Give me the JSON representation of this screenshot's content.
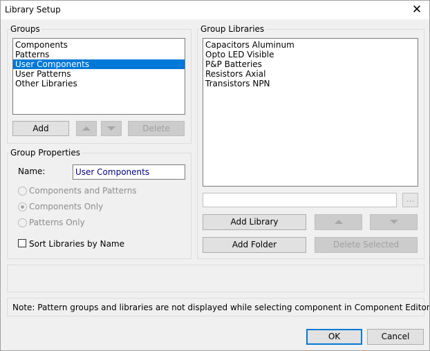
{
  "window": {
    "title": "Library Setup"
  },
  "groups": {
    "label": "Groups",
    "items": [
      "Components",
      "Patterns",
      "User Components",
      "User Patterns",
      "Other Libraries"
    ],
    "selected_index": 2,
    "add_label": "Add",
    "delete_label": "Delete"
  },
  "group_properties": {
    "label": "Group Properties",
    "name_label": "Name:",
    "name_value": "User Components",
    "radio_components_patterns": "Components and Patterns",
    "radio_components_only": "Components Only",
    "radio_patterns_only": "Patterns Only",
    "sort_label": "Sort Libraries by Name",
    "sort_checked": false
  },
  "group_libraries": {
    "label": "Group Libraries",
    "items": [
      "Capacitors Aluminum",
      "Opto LED Visible",
      "P&P Batteries",
      "Resistors Axial",
      "Transistors NPN"
    ],
    "path_value": "",
    "browse_label": "...",
    "add_library_label": "Add Library",
    "add_folder_label": "Add Folder",
    "delete_selected_label": "Delete Selected"
  },
  "note": "Note: Pattern groups and libraries are not displayed while selecting component in Component Editor.",
  "buttons": {
    "ok": "OK",
    "cancel": "Cancel"
  },
  "colors": {
    "selection": "#0078d7",
    "name_text": "#000080",
    "default_border": "#0078d7"
  }
}
